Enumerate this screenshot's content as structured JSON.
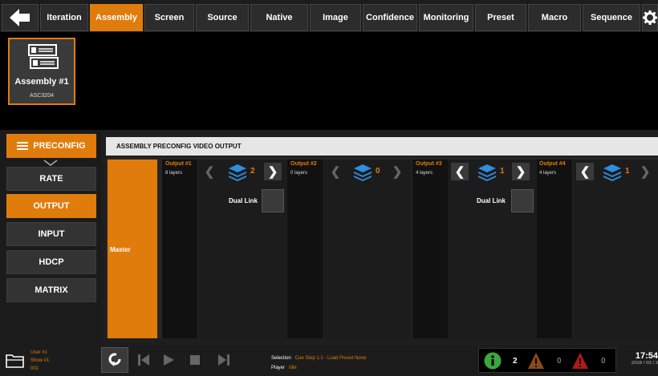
{
  "nav": {
    "tabs": [
      {
        "label": "Iteration",
        "active": false
      },
      {
        "label": "Assembly",
        "active": true
      },
      {
        "label": "Screen",
        "active": false
      },
      {
        "label": "Source",
        "active": false
      },
      {
        "label": "Native",
        "active": false
      },
      {
        "label": "Image",
        "active": false
      },
      {
        "label": "Confidence",
        "active": false
      },
      {
        "label": "Monitoring",
        "active": false
      },
      {
        "label": "Preset",
        "active": false
      },
      {
        "label": "Macro",
        "active": false
      },
      {
        "label": "Sequence",
        "active": false
      }
    ],
    "back_icon": "back-arrow-icon",
    "settings_icon": "gear-icon"
  },
  "assembly": {
    "name": "Assembly #1",
    "model": "ASC3204",
    "icon": "device-icon"
  },
  "menu": {
    "preconfig_label": "PRECONFIG",
    "items": [
      {
        "label": "RATE",
        "active": false
      },
      {
        "label": "OUTPUT",
        "active": true
      },
      {
        "label": "INPUT",
        "active": false
      },
      {
        "label": "HDCP",
        "active": false
      },
      {
        "label": "MATRIX",
        "active": false
      }
    ]
  },
  "content": {
    "header": "ASSEMBLY PRECONFIG VIDEO OUTPUT",
    "master_label": "Master",
    "dual_link_label": "Dual Link",
    "outputs": [
      {
        "title": "Output #1",
        "layers": "8 layers",
        "count": "2",
        "dual_link": true
      },
      {
        "title": "Output #2",
        "layers": "0 layers",
        "count": "0",
        "dual_link": false
      },
      {
        "title": "Output #3",
        "layers": "4 layers",
        "count": "1",
        "dual_link": true
      },
      {
        "title": "Output #4",
        "layers": "4 layers",
        "count": "1",
        "dual_link": false
      }
    ]
  },
  "footer": {
    "user": "User #1",
    "show": "Show #1",
    "show_number": "001",
    "selection_label": "Selection",
    "selection_value": "Cue Step 1.1 - Load Preset None",
    "player_label": "Player",
    "player_value": "Idle",
    "info_count": "2",
    "warning_count": "0",
    "error_count": "0",
    "time": "17:54",
    "date": "2016 / 03 / 3",
    "colors": {
      "accent": "#e07c0c",
      "info": "#3ba63b",
      "warning": "#8a4a16",
      "error": "#b01818"
    }
  }
}
